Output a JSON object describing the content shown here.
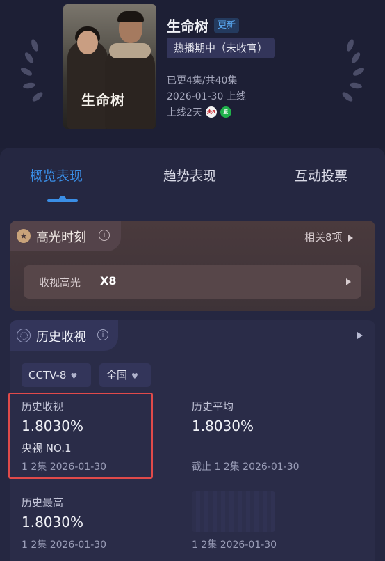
{
  "show": {
    "poster_text": "生命树",
    "title": "生命树",
    "badge": "更新",
    "status": "热播期中（未收官）",
    "episodes": "已更4集/共40集",
    "launch": "2026-01-30 上线",
    "days_online": "上线2天",
    "platforms": [
      "cctv8-icon",
      "iqiyi-icon"
    ]
  },
  "tabs": [
    {
      "label": "概览表现",
      "active": true
    },
    {
      "label": "趋势表现",
      "active": false
    },
    {
      "label": "互动投票",
      "active": false
    }
  ],
  "highlight": {
    "title": "高光时刻",
    "info": "i",
    "related": "相关8项",
    "row_label": "收视高光",
    "row_value": "X8"
  },
  "history": {
    "title": "历史收视",
    "info": "i",
    "channel": "CCTV-8",
    "region": "全国",
    "stats": {
      "history_rating": {
        "label": "历史收视",
        "value": "1.8030%",
        "rank": "央视 NO.1",
        "sub": "1 2集 2026-01-30"
      },
      "history_average": {
        "label": "历史平均",
        "value": "1.8030%",
        "sub": "截止 1 2集 2026-01-30"
      },
      "history_high": {
        "label": "历史最高",
        "value": "1.8030%",
        "sub": "1 2集 2026-01-30"
      },
      "extra_sub": "1 2集 2026-01-30"
    }
  },
  "colors": {
    "accent": "#3a8ee6",
    "highlight_box": "#e04a4a"
  }
}
